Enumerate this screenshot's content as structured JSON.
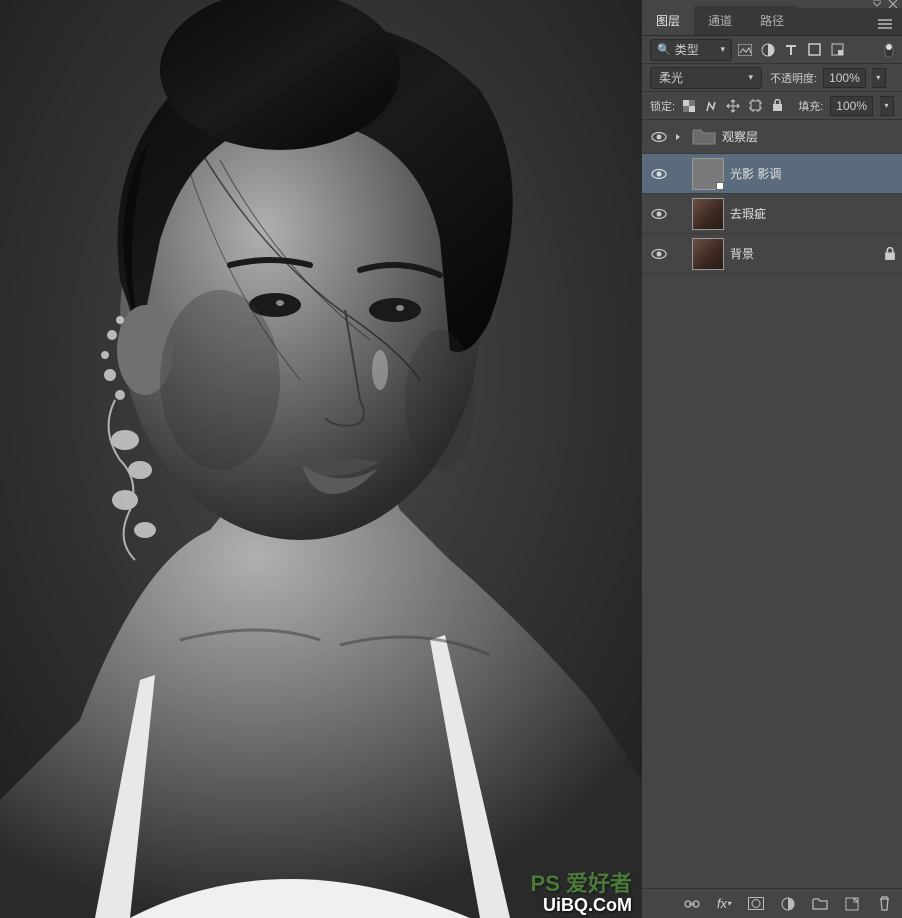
{
  "panel": {
    "tabs": [
      "图层",
      "通道",
      "路径"
    ],
    "active_tab": 0,
    "filter": {
      "kind_label": "类型"
    },
    "blend": {
      "mode": "柔光",
      "opacity_label": "不透明度:",
      "opacity_value": "100%"
    },
    "lock": {
      "label": "锁定:",
      "fill_label": "填充:",
      "fill_value": "100%"
    },
    "layers": [
      {
        "name": "观察层",
        "type": "group",
        "visible": true,
        "selected": false,
        "locked": false
      },
      {
        "name": "光影 影调",
        "type": "fill",
        "visible": true,
        "selected": true,
        "locked": false
      },
      {
        "name": "去瑕疵",
        "type": "image",
        "visible": true,
        "selected": false,
        "locked": false
      },
      {
        "name": "背景",
        "type": "image",
        "visible": true,
        "selected": false,
        "locked": true
      }
    ]
  },
  "watermark1": "PS 爱好者",
  "watermark2": "UiBQ.CoM"
}
